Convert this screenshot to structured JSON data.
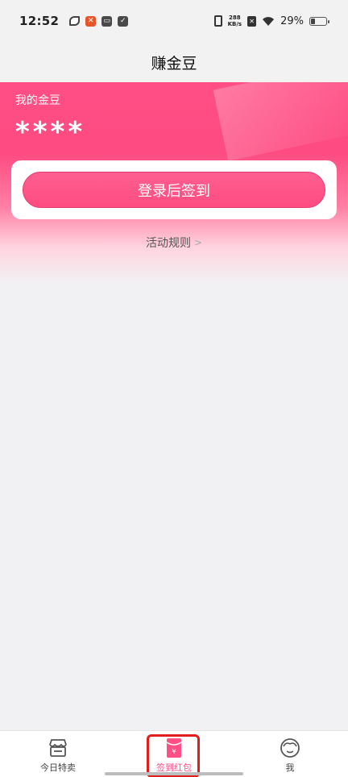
{
  "status": {
    "time": "12:52",
    "speed_value": "288",
    "speed_unit": "KB/s",
    "battery": "29%"
  },
  "header": {
    "title": "赚金豆"
  },
  "bean": {
    "label": "我的金豆",
    "value": "****"
  },
  "signin": {
    "button_label": "登录后签到"
  },
  "rules": {
    "label": "活动规则",
    "chevron": ">"
  },
  "tabs": [
    {
      "label": "今日特卖",
      "icon": "store-icon",
      "active": false
    },
    {
      "label": "签到红包",
      "icon": "red-envelope-icon",
      "active": true
    },
    {
      "label": "我",
      "icon": "face-icon",
      "active": false
    }
  ],
  "colors": {
    "brand": "#FE4B82",
    "highlight": "#E01E1E"
  }
}
